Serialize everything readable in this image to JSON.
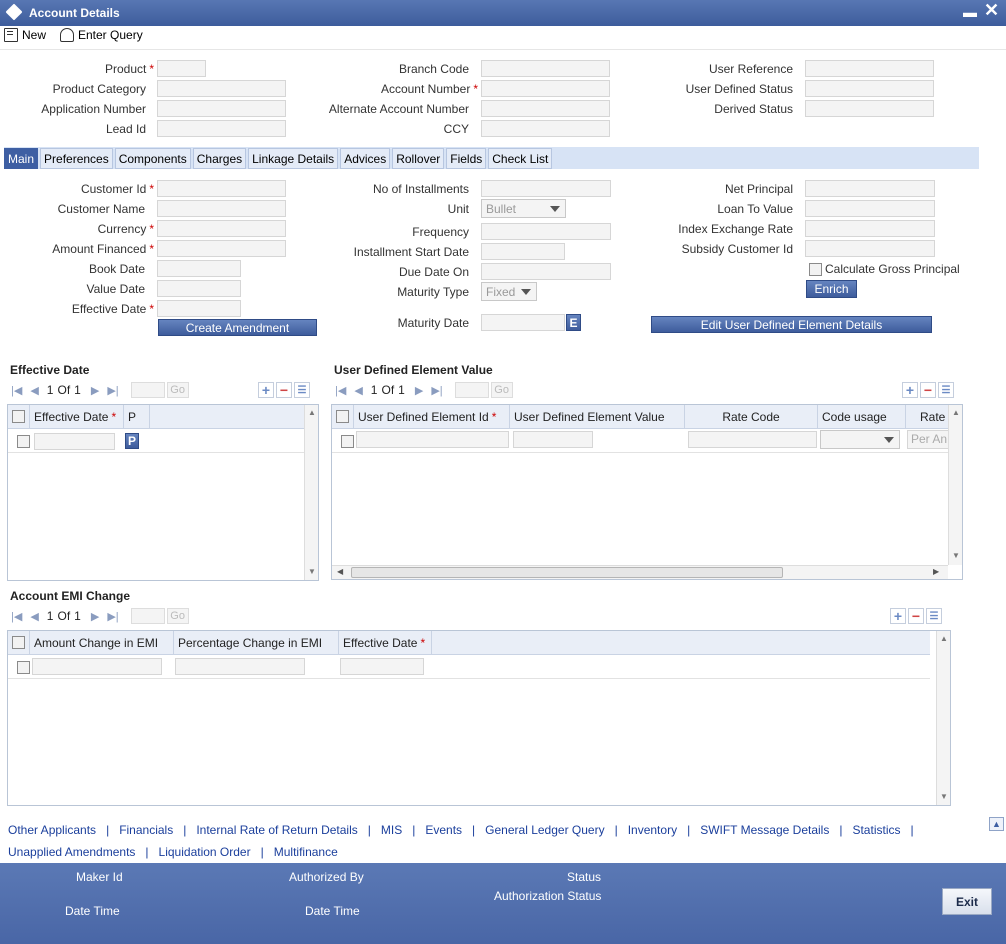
{
  "window": {
    "title": "Account Details"
  },
  "toolbar": {
    "new_label": "New",
    "enter_query_label": "Enter Query"
  },
  "header": {
    "product": "Product",
    "product_category": "Product Category",
    "application_number": "Application Number",
    "lead_id": "Lead Id",
    "branch_code": "Branch Code",
    "account_number": "Account Number",
    "alternate_account_number": "Alternate Account Number",
    "ccy": "CCY",
    "user_reference": "User Reference",
    "user_defined_status": "User Defined Status",
    "derived_status": "Derived Status"
  },
  "tabs": [
    "Main",
    "Preferences",
    "Components",
    "Charges",
    "Linkage Details",
    "Advices",
    "Rollover",
    "Fields",
    "Check List"
  ],
  "main": {
    "customer_id": "Customer Id",
    "customer_name": "Customer Name",
    "currency": "Currency",
    "amount_financed": "Amount Financed",
    "book_date": "Book Date",
    "value_date": "Value Date",
    "effective_date": "Effective Date",
    "no_of_installments": "No of Installments",
    "unit": "Unit",
    "unit_value": "Bullet",
    "frequency": "Frequency",
    "installment_start_date": "Installment Start Date",
    "due_date_on": "Due Date On",
    "maturity_type": "Maturity Type",
    "maturity_type_value": "Fixed",
    "maturity_date": "Maturity Date",
    "maturity_date_btn": "E",
    "net_principal": "Net Principal",
    "loan_to_value": "Loan To Value",
    "index_exchange_rate": "Index Exchange Rate",
    "subsidy_customer_id": "Subsidy Customer Id",
    "calculate_gross_principal": "Calculate Gross Principal",
    "enrich": "Enrich",
    "create_amendment": "Create Amendment",
    "edit_ude": "Edit User Defined Element Details"
  },
  "effective_date_grid": {
    "title": "Effective Date",
    "page": "1",
    "of": "Of",
    "total": "1",
    "go": "Go",
    "columns": [
      "Effective Date",
      "P"
    ],
    "row_btn": "P"
  },
  "ude_grid": {
    "title": "User Defined Element Value",
    "page": "1",
    "of": "Of",
    "total": "1",
    "go": "Go",
    "columns": [
      "User Defined Element Id",
      "User Defined Element Value",
      "Rate Code",
      "Code usage",
      "Rate"
    ],
    "rate_placeholder": "Per An"
  },
  "emi_grid": {
    "title": "Account EMI Change",
    "page": "1",
    "of": "Of",
    "total": "1",
    "go": "Go",
    "columns": [
      "Amount Change in EMI",
      "Percentage Change in EMI",
      "Effective Date"
    ]
  },
  "links": {
    "row1": [
      "Other Applicants",
      "Financials",
      "Internal Rate of Return Details",
      "MIS",
      "Events",
      "General Ledger Query",
      "Inventory",
      "SWIFT Message Details",
      "Statistics"
    ],
    "row2": [
      "Unapplied Amendments",
      "Liquidation Order",
      "Multifinance"
    ]
  },
  "footer": {
    "maker_id": "Maker Id",
    "date_time": "Date Time",
    "authorized_by": "Authorized By",
    "date_time2": "Date Time",
    "status": "Status",
    "authorization_status": "Authorization Status",
    "exit": "Exit"
  }
}
